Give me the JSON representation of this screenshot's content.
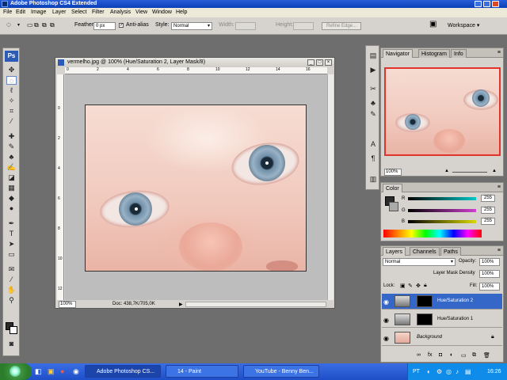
{
  "app": {
    "title": "Adobe Photoshop CS4 Extended"
  },
  "menu": {
    "items": [
      "File",
      "Edit",
      "Image",
      "Layer",
      "Select",
      "Filter",
      "Analysis",
      "View",
      "Window",
      "Help"
    ]
  },
  "options": {
    "feather_label": "Feather:",
    "feather_value": "0 px",
    "antialias_label": "Anti-alias",
    "style_label": "Style:",
    "style_value": "Normal",
    "width_label": "Width:",
    "height_label": "Height:",
    "refine_label": "Refine Edge...",
    "workspace_label": "Workspace"
  },
  "tools": {
    "logo": "Ps"
  },
  "document": {
    "title": "vermelho.jpg @ 100% (Hue/Saturation 2, Layer Mask/8)",
    "zoom": "100%",
    "doc_info": "Doc: 438,7K/705,0K",
    "ruler_h": [
      "0",
      "2",
      "4",
      "6",
      "8",
      "10",
      "12",
      "14",
      "16"
    ],
    "ruler_v": [
      "0",
      "2",
      "4",
      "6",
      "8",
      "10",
      "12"
    ]
  },
  "navigator": {
    "tabs": [
      "Navigator",
      "Histogram",
      "Info"
    ],
    "zoom": "100%"
  },
  "color": {
    "tab": "Color",
    "r_label": "R",
    "g_label": "G",
    "b_label": "B",
    "r": "255",
    "g": "255",
    "b": "255",
    "r_color": "#00c8c8",
    "g_color": "#d040d0",
    "b_color": "#d8d800"
  },
  "layers": {
    "tabs": [
      "Layers",
      "Channels",
      "Paths"
    ],
    "blend_mode": "Normal",
    "opacity_label": "Opacity:",
    "opacity": "100%",
    "density_label": "Layer Mask Density",
    "density": "100%",
    "lock_label": "Lock:",
    "fill_label": "Fill:",
    "fill": "100%",
    "items": [
      {
        "name": "Hue/Saturation 2",
        "selected": true
      },
      {
        "name": "Hue/Saturation 1",
        "selected": false
      },
      {
        "name": "Background",
        "selected": false
      }
    ],
    "bottom_icons": [
      "link-icon",
      "fx-icon",
      "mask-icon",
      "adjustment-icon",
      "folder-icon",
      "new-layer-icon",
      "trash-icon"
    ]
  },
  "taskbar": {
    "buttons": [
      "Adobe Photoshop CS...",
      "14 - Paint",
      "YouTube - Benny Ben..."
    ],
    "clock": "16:26",
    "lang": "PT"
  }
}
